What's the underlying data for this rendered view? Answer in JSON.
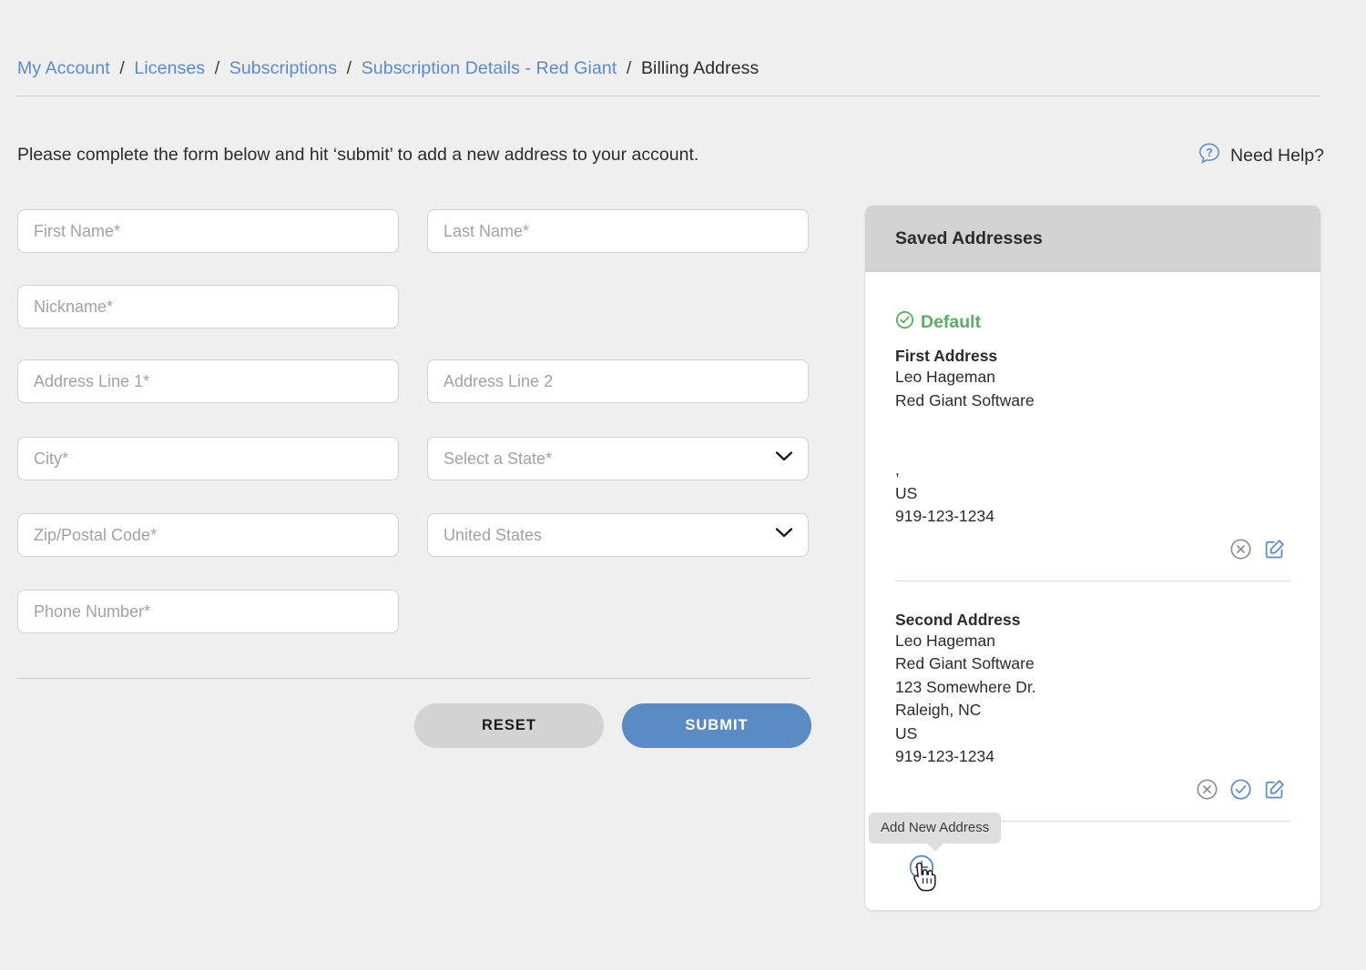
{
  "breadcrumb": {
    "items": [
      {
        "label": "My Account",
        "current": false
      },
      {
        "label": "Licenses",
        "current": false
      },
      {
        "label": "Subscriptions",
        "current": false
      },
      {
        "label": "Subscription Details - Red Giant",
        "current": false
      },
      {
        "label": "Billing Address",
        "current": true
      }
    ],
    "separator": "/"
  },
  "intro": {
    "text": "Please complete the form below and hit ‘submit’ to add a new address to your account."
  },
  "help": {
    "label": "Need Help?",
    "icon": "question-bubble-icon",
    "color": "#5b8bc9"
  },
  "form": {
    "fields": [
      {
        "name": "first-name",
        "placeholder": "First Name*",
        "type": "text",
        "value": ""
      },
      {
        "name": "last-name",
        "placeholder": "Last Name*",
        "type": "text",
        "value": ""
      },
      {
        "name": "nickname",
        "placeholder": "Nickname*",
        "type": "text",
        "value": ""
      },
      {
        "name": "address-line-1",
        "placeholder": "Address Line 1*",
        "type": "text",
        "value": ""
      },
      {
        "name": "address-line-2",
        "placeholder": "Address Line 2",
        "type": "text",
        "value": ""
      },
      {
        "name": "city",
        "placeholder": "City*",
        "type": "text",
        "value": ""
      },
      {
        "name": "state",
        "placeholder": "Select a State*",
        "type": "select",
        "value": ""
      },
      {
        "name": "zip",
        "placeholder": "Zip/Postal Code*",
        "type": "text",
        "value": ""
      },
      {
        "name": "country",
        "placeholder": "United States",
        "type": "select",
        "value": "United States"
      },
      {
        "name": "phone",
        "placeholder": "Phone Number*",
        "type": "text",
        "value": ""
      }
    ],
    "reset_label": "RESET",
    "submit_label": "SUBMIT",
    "reset_color": "#d3d3d3",
    "submit_color": "#5b8bc4"
  },
  "saved_addresses": {
    "title": "Saved Addresses",
    "default_badge": {
      "label": "Default",
      "icon": "check-circle-icon",
      "color": "#5aad62"
    },
    "entries": [
      {
        "title": "First Address",
        "is_default": true,
        "lines": [
          "Leo Hageman",
          "Red Giant Software",
          "",
          "",
          ",",
          "US",
          "919-123-1234"
        ],
        "actions": [
          {
            "name": "delete-address-icon",
            "icon": "x-circle-icon",
            "color": "#8c8c8c"
          },
          {
            "name": "edit-address-icon",
            "icon": "pencil-square-icon",
            "color": "#5b8bc4"
          }
        ]
      },
      {
        "title": "Second Address",
        "is_default": false,
        "lines": [
          "Leo Hageman",
          "Red Giant Software",
          "123 Somewhere Dr.",
          "Raleigh, NC",
          "US",
          "919-123-1234"
        ],
        "actions": [
          {
            "name": "delete-address-icon",
            "icon": "x-circle-icon",
            "color": "#8c8c8c"
          },
          {
            "name": "set-default-address-icon",
            "icon": "check-circle-icon",
            "color": "#5b8bc4"
          },
          {
            "name": "edit-address-icon",
            "icon": "pencil-square-icon",
            "color": "#5b8bc4"
          }
        ]
      }
    ],
    "add_new": {
      "tooltip": "Add New Address",
      "icon": "plus-circle-icon",
      "color": "#5b8bc4"
    }
  }
}
